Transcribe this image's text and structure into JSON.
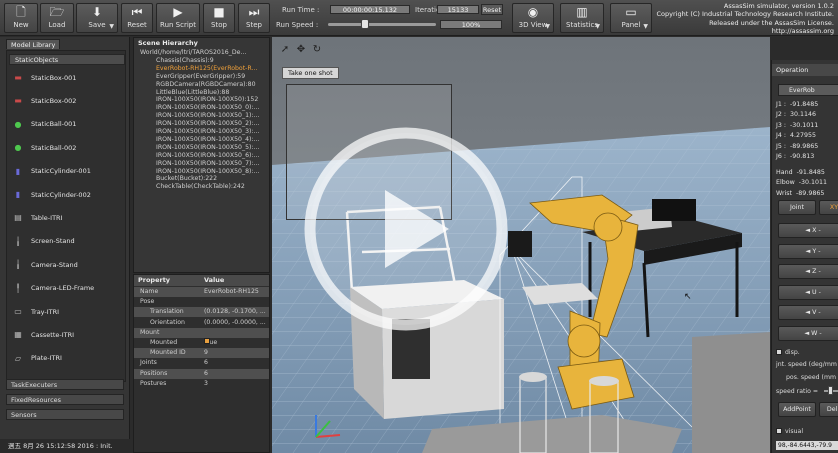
{
  "toolbar": {
    "new": "New",
    "load": "Load",
    "save": "Save",
    "reset": "Reset",
    "run_script": "Run Script",
    "stop": "Stop",
    "step": "Step",
    "view_3d": "3D View",
    "statistics": "Statistics",
    "panel": "Panel",
    "run_time_label": "Run Time :",
    "run_time_value": "00:00:00:15.132",
    "iterations_label": "Iterations :",
    "iterations_value": "15133",
    "reset_small": "Reset",
    "run_speed_label": "Run Speed :",
    "run_speed_value": "100%",
    "run_speed_fraction": 0.34
  },
  "about": {
    "line1": "AssasSim simulator, version 1.0.2",
    "line2": "Copyright (C) Industrial Technology Research Institute.",
    "line3": "Released under the AssasSim License.",
    "line4": "http://assassim.org"
  },
  "model_library": {
    "tab": "Model Library",
    "static_header": "StaticObjects",
    "items": [
      {
        "label": "StaticBox-001",
        "icon": "box-icon",
        "color": "#c94a4a"
      },
      {
        "label": "StaticBox-002",
        "icon": "box-icon",
        "color": "#c94a4a"
      },
      {
        "label": "StaticBall-001",
        "icon": "ball-icon",
        "color": "#4ec84e"
      },
      {
        "label": "StaticBall-002",
        "icon": "ball-icon",
        "color": "#4ec84e"
      },
      {
        "label": "StaticCylinder-001",
        "icon": "cylinder-icon",
        "color": "#6a6ad8"
      },
      {
        "label": "StaticCylinder-002",
        "icon": "cylinder-icon",
        "color": "#6a6ad8"
      },
      {
        "label": "Table-ITRI",
        "icon": "table-icon",
        "color": "#bbbbbb"
      },
      {
        "label": "Screen-Stand",
        "icon": "stand-icon",
        "color": "#bbbbbb"
      },
      {
        "label": "Camera-Stand",
        "icon": "stand-icon",
        "color": "#bbbbbb"
      },
      {
        "label": "Camera-LED-Frame",
        "icon": "frame-icon",
        "color": "#bbbbbb"
      },
      {
        "label": "Tray-ITRI",
        "icon": "tray-icon",
        "color": "#bbbbbb"
      },
      {
        "label": "Cassette-ITRI",
        "icon": "cassette-icon",
        "color": "#bbbbbb"
      },
      {
        "label": "Plate-ITRI",
        "icon": "plate-icon",
        "color": "#bbbbbb"
      }
    ],
    "sections": [
      "TaskExecuters",
      "FixedResources",
      "Sensors"
    ]
  },
  "status": "週五 8月 26 15:12:58 2016 : Init.",
  "scene": {
    "title": "Scene Hierarchy",
    "items": [
      {
        "label": "World(/home/ltri/TAROS2016_De...",
        "indent": 0,
        "sel": false
      },
      {
        "label": "Chassis(Chassis):9",
        "indent": 1,
        "sel": false
      },
      {
        "label": "EverRobot-RH125(EverRobot-R...",
        "indent": 1,
        "sel": true
      },
      {
        "label": "EverGripper(EverGripper):59",
        "indent": 1,
        "sel": false
      },
      {
        "label": "RGBDCamera(RGBDCamera):80",
        "indent": 1,
        "sel": false
      },
      {
        "label": "LittleBlue(LittleBlue):88",
        "indent": 1,
        "sel": false
      },
      {
        "label": "IRON-100X50(IRON-100X50):152",
        "indent": 1,
        "sel": false
      },
      {
        "label": "IRON-100X50(IRON-100X50_0):...",
        "indent": 1,
        "sel": false
      },
      {
        "label": "IRON-100X50(IRON-100X50_1):...",
        "indent": 1,
        "sel": false
      },
      {
        "label": "IRON-100X50(IRON-100X50_2):...",
        "indent": 1,
        "sel": false
      },
      {
        "label": "IRON-100X50(IRON-100X50_3):...",
        "indent": 1,
        "sel": false
      },
      {
        "label": "IRON-100X50(IRON-100X50_4):...",
        "indent": 1,
        "sel": false
      },
      {
        "label": "IRON-100X50(IRON-100X50_5):...",
        "indent": 1,
        "sel": false
      },
      {
        "label": "IRON-100X50(IRON-100X50_6):...",
        "indent": 1,
        "sel": false
      },
      {
        "label": "IRON-100X50(IRON-100X50_7):...",
        "indent": 1,
        "sel": false
      },
      {
        "label": "IRON-100X50(IRON-100X50_8):...",
        "indent": 1,
        "sel": false
      },
      {
        "label": "Bucket(Bucket):222",
        "indent": 1,
        "sel": false
      },
      {
        "label": "CheckTable(CheckTable):242",
        "indent": 1,
        "sel": false
      }
    ]
  },
  "properties": {
    "col_property": "Property",
    "col_value": "Value",
    "rows": [
      {
        "k": "Name",
        "v": "EverRobot-RH125",
        "indent": 1,
        "hl": true,
        "chk": false
      },
      {
        "k": "Pose",
        "v": "",
        "indent": 1,
        "hl": false,
        "chk": false
      },
      {
        "k": "Translation",
        "v": "(0.0128, -0.1700, ...",
        "indent": 2,
        "hl": true,
        "chk": false
      },
      {
        "k": "Orientation",
        "v": "(0.0000, -0.0000, ...",
        "indent": 2,
        "hl": false,
        "chk": false
      },
      {
        "k": "Mount",
        "v": "",
        "indent": 1,
        "hl": true,
        "chk": false
      },
      {
        "k": "Mounted",
        "v": "True",
        "indent": 2,
        "hl": false,
        "chk": true
      },
      {
        "k": "Mounted ID",
        "v": "9",
        "indent": 2,
        "hl": true,
        "chk": false
      },
      {
        "k": "Joints",
        "v": "6",
        "indent": 1,
        "hl": false,
        "chk": false
      },
      {
        "k": "Positions",
        "v": "6",
        "indent": 1,
        "hl": true,
        "chk": false
      },
      {
        "k": "Postures",
        "v": "3",
        "indent": 1,
        "hl": false,
        "chk": false
      }
    ]
  },
  "viewport": {
    "take_one_shot": "Take one shot"
  },
  "operation": {
    "title": "Operation",
    "robot_select": "EverRob",
    "joints": [
      {
        "k": "J1 :",
        "v": "-91.8485"
      },
      {
        "k": "J2 :",
        "v": "30.1146"
      },
      {
        "k": "J3 :",
        "v": "-30.1011"
      },
      {
        "k": "J4 :",
        "v": "4.27955"
      },
      {
        "k": "J5 :",
        "v": "-89.9865"
      },
      {
        "k": "J6 :",
        "v": "-90.813"
      },
      {
        "k": "Hand",
        "v": "-91.8485"
      },
      {
        "k": "Elbow",
        "v": "-30.1011"
      },
      {
        "k": "Wrist",
        "v": "-89.9865"
      }
    ],
    "joint_btn": "Joint",
    "xyz_btn": "XY",
    "axis_buttons": [
      "◄ X -",
      "◄ Y -",
      "◄ Z -",
      "◄ U -",
      "◄ V -",
      "◄ W -"
    ],
    "disp_label": "disp.",
    "jnt_speed": "jnt. speed (deg/mm",
    "pos_speed": "pos. speed (mm",
    "speed_ratio": "speed ratio =",
    "add_point": "AddPoint",
    "del_point": "DelP",
    "visual": "visual",
    "position_value": "98,-84.6443,-79.9"
  }
}
